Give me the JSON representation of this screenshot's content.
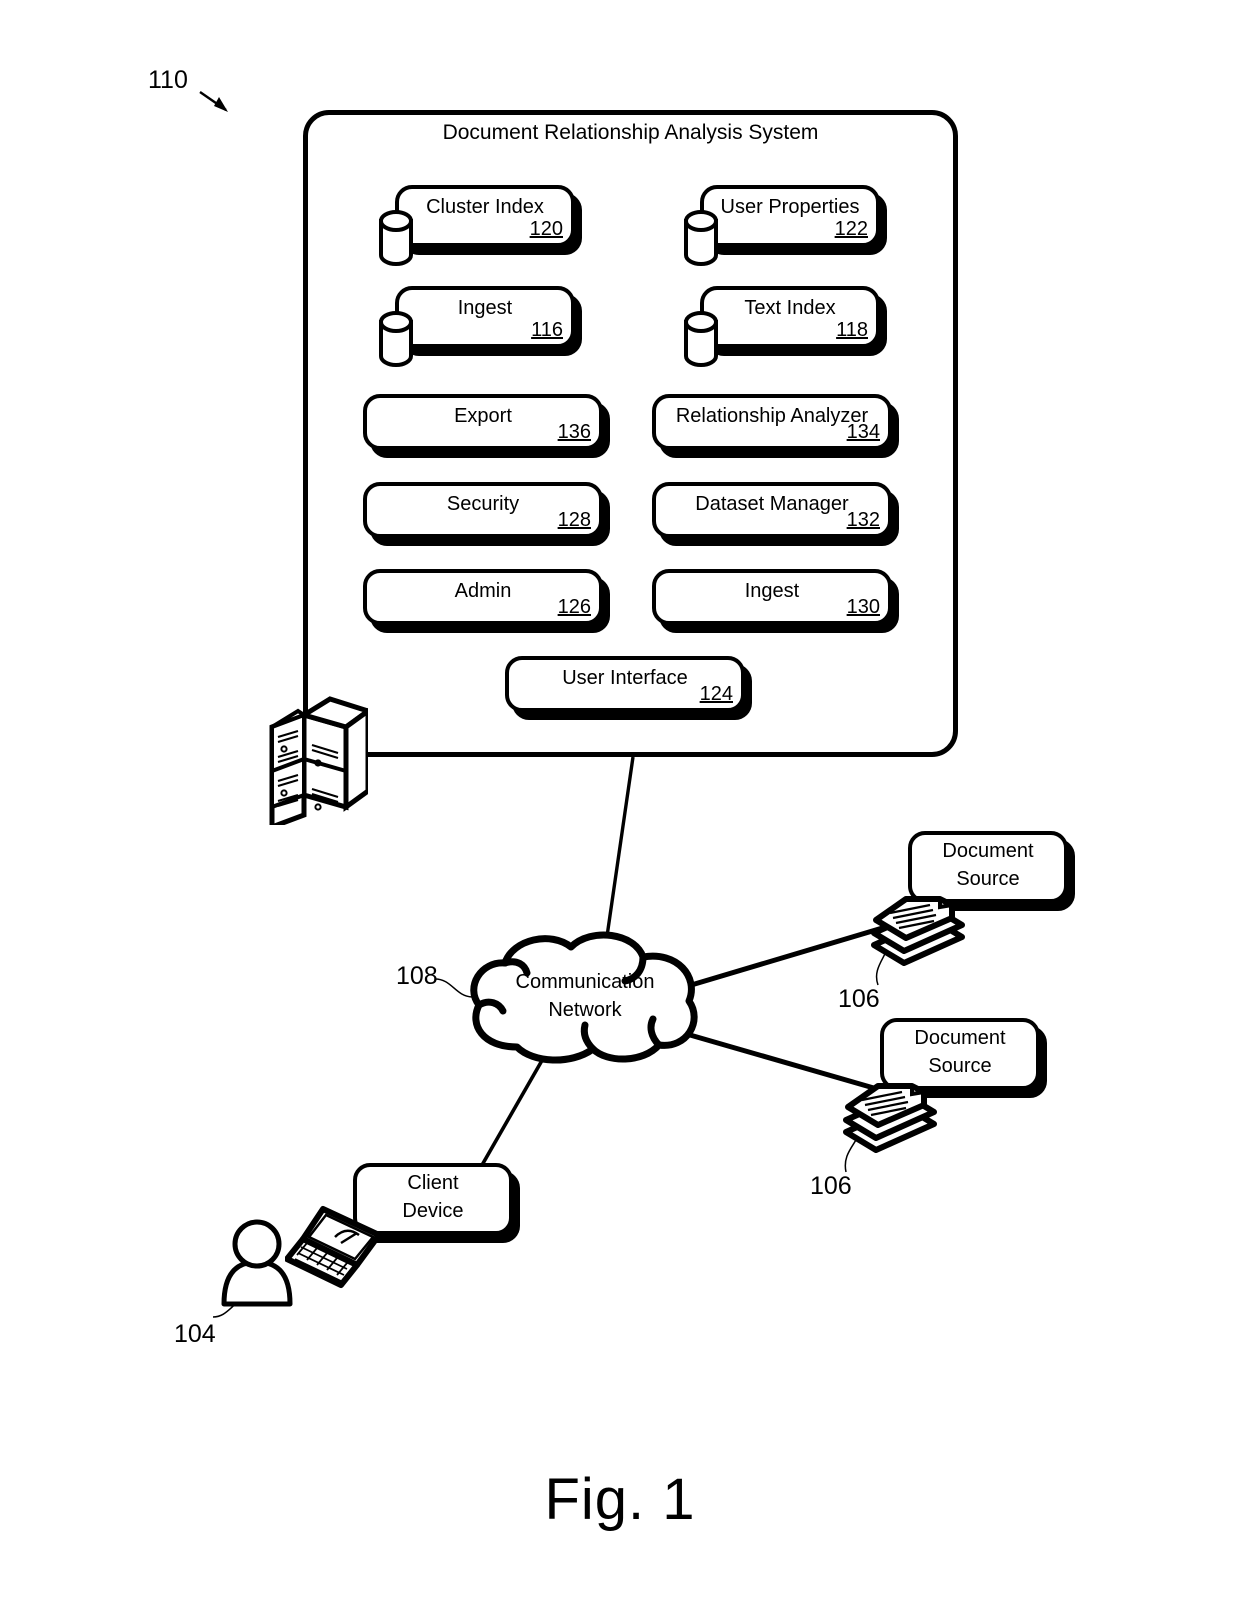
{
  "figure": {
    "caption": "Fig. 1",
    "system_ref": "110",
    "user_ref": "104",
    "network_ref": "108",
    "doc_source_ref_1": "106",
    "doc_source_ref_2": "106"
  },
  "system": {
    "title": "Document Relationship Analysis System",
    "datastores": [
      {
        "label": "Cluster Index",
        "num": "120",
        "icon": "database-cylinder-icon"
      },
      {
        "label": "User Properties",
        "num": "122",
        "icon": "database-cylinder-icon"
      },
      {
        "label": "Ingest",
        "num": "116",
        "icon": "database-cylinder-icon"
      },
      {
        "label": "Text Index",
        "num": "118",
        "icon": "database-cylinder-icon"
      }
    ],
    "modules": [
      {
        "label": "Export",
        "num": "136"
      },
      {
        "label": "Relationship Analyzer",
        "num": "134"
      },
      {
        "label": "Security",
        "num": "128"
      },
      {
        "label": "Dataset Manager",
        "num": "132"
      },
      {
        "label": "Admin",
        "num": "126"
      },
      {
        "label": "Ingest",
        "num": "130"
      }
    ],
    "user_interface": {
      "label": "User Interface",
      "num": "124"
    },
    "server_icon": "server-rack-icon"
  },
  "network": {
    "label_line1": "Communication",
    "label_line2": "Network",
    "icon": "cloud-icon"
  },
  "document_sources": [
    {
      "label_line1": "Document",
      "label_line2": "Source",
      "icon": "document-stack-icon"
    },
    {
      "label_line1": "Document",
      "label_line2": "Source",
      "icon": "document-stack-icon"
    }
  ],
  "client": {
    "label_line1": "Client",
    "label_line2": "Device",
    "device_icon": "laptop-icon",
    "user_icon": "person-icon"
  },
  "colors": {
    "ink": "#000000",
    "paper": "#ffffff"
  }
}
